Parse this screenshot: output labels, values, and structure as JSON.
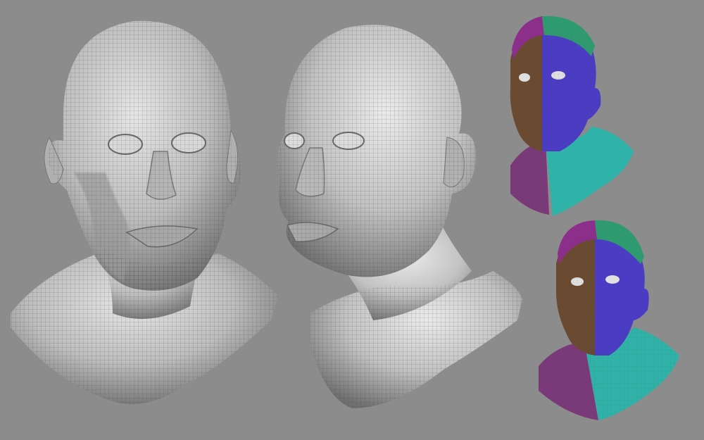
{
  "scene": {
    "background": "#8c8c8c",
    "views": [
      {
        "id": "front-wireframe",
        "render": "wireframe",
        "colors": {
          "base": "#c9c9c9",
          "shade": "#7d7d7d",
          "wire": "#4a4a4a"
        }
      },
      {
        "id": "three-quarter-wireframe",
        "render": "wireframe",
        "colors": {
          "base": "#cdcdcd",
          "shade": "#808080",
          "wire": "#4a4a4a"
        }
      },
      {
        "id": "polygroups-top",
        "render": "polygroups"
      },
      {
        "id": "polygroups-bottom",
        "render": "polygroups"
      }
    ],
    "polygroup_colors": {
      "crown_left": "#8b2f8a",
      "crown_right": "#2f9a6f",
      "face_left": "#6b4a32",
      "face_right": "#4b3cc4",
      "neck_left": "#7a3a7a",
      "neck_right": "#2fb3a8"
    }
  }
}
